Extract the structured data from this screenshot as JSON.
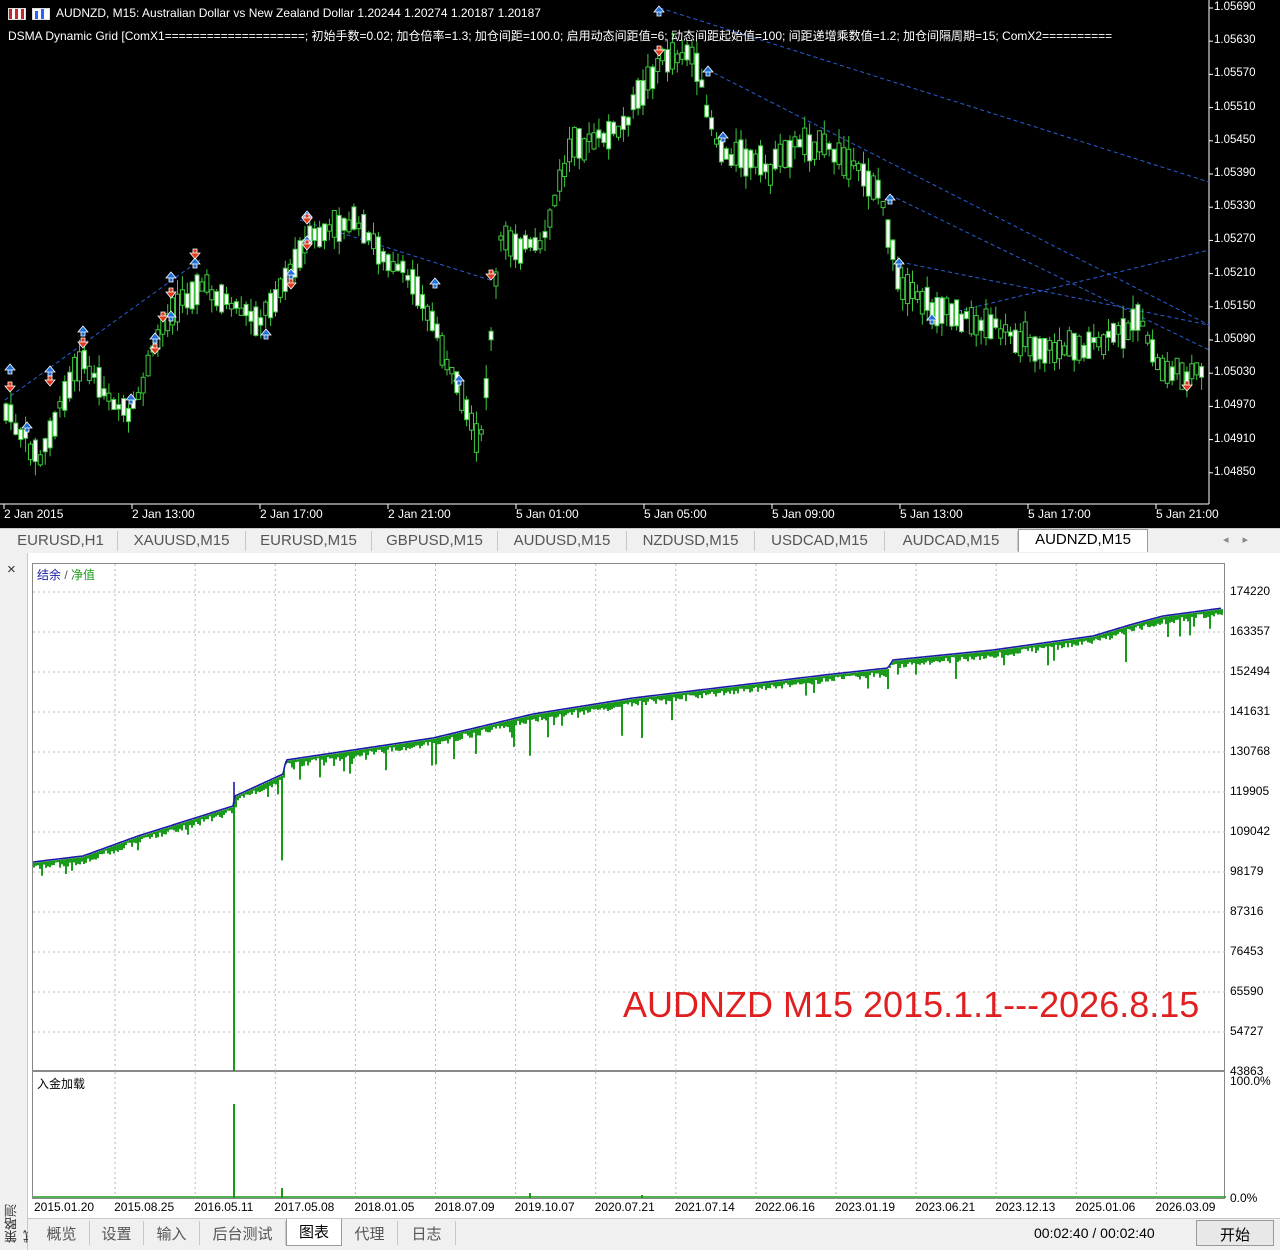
{
  "price_chart": {
    "header_text": "AUDNZD, M15:  Australian Dollar vs New Zealand Dollar  1.20244 1.20274 1.20187 1.20187",
    "indicator_text": "DSMA Dynamic Grid [ComX1====================; 初始手数=0.02; 加仓倍率=1.3; 加仓间距=100.0; 启用动态间距值=6; 动态间距起始值=100; 间距递增乘数值=1.2; 加仓间隔周期=15; ComX2==========",
    "price_labels": [
      "1.05690",
      "1.05630",
      "1.05570",
      "1.05510",
      "1.05450",
      "1.05390",
      "1.05330",
      "1.05270",
      "1.05210",
      "1.05150",
      "1.05090",
      "1.05030",
      "1.04970",
      "1.04910",
      "1.04850"
    ],
    "time_labels": [
      "2 Jan 2015",
      "2 Jan 13:00",
      "2 Jan 17:00",
      "2 Jan 21:00",
      "5 Jan 01:00",
      "5 Jan 05:00",
      "5 Jan 09:00",
      "5 Jan 13:00",
      "5 Jan 17:00",
      "5 Jan 21:00"
    ],
    "colors": {
      "background": "#000000",
      "candle": "#3ec93e",
      "buy_arrow": "#1e6fd9",
      "sell_arrow": "#e0391c",
      "trend_line": "#2a5fd8"
    }
  },
  "symbol_tabs": [
    "EURUSD,H1",
    "XAUUSD,M15",
    "EURUSD,M15",
    "GBPUSD,M15",
    "AUDUSD,M15",
    "NZDUSD,M15",
    "USDCAD,M15",
    "AUDCAD,M15",
    "AUDNZD,M15"
  ],
  "active_symbol_tab": "AUDNZD,M15",
  "tester": {
    "close_icon": "×",
    "side_label": "策略测试",
    "legend_balance": "结余",
    "legend_sep": " / ",
    "legend_equity": "净值",
    "annotation": "AUDNZD M15 2015.1.1---2026.8.15",
    "equity_axis": [
      "174220",
      "163357",
      "152494",
      "141631",
      "130768",
      "119905",
      "109042",
      "98179",
      "87316",
      "76453",
      "65590",
      "54727",
      "43863"
    ],
    "deposit_label": "入金加载",
    "deposit_axis": [
      "100.0%",
      "0.0%"
    ],
    "date_labels": [
      "2015.01.20",
      "2015.08.25",
      "2016.05.11",
      "2017.05.08",
      "2018.01.05",
      "2018.07.09",
      "2019.10.07",
      "2020.07.21",
      "2021.07.14",
      "2022.06.16",
      "2023.01.19",
      "2023.06.21",
      "2023.12.13",
      "2025.01.06",
      "2026.03.09"
    ],
    "colors": {
      "balance": "#1a1aa8",
      "equity": "#1a9a1a",
      "annotation": "#e02020"
    }
  },
  "bottom_tabs": [
    "概览",
    "设置",
    "输入",
    "后台测试",
    "图表",
    "代理",
    "日志"
  ],
  "active_bottom_tab": "图表",
  "timer": "00:02:40 / 00:02:40",
  "start_button": "开始"
}
